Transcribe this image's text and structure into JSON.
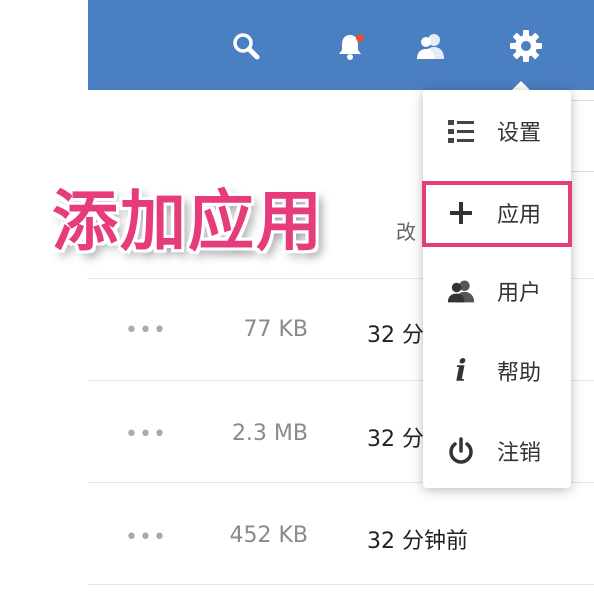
{
  "header": {
    "icons": [
      "search-icon",
      "bell-icon",
      "contacts-icon",
      "gear-icon"
    ],
    "notification_dot_color": "#e0523f",
    "bar_color": "#4a7fc1"
  },
  "overlay": {
    "title": "添加应用",
    "color": "#e63c7c"
  },
  "column_hint": "改",
  "files": [
    {
      "more": "•••",
      "size": "77 KB",
      "modified": "32 分"
    },
    {
      "more": "•••",
      "size": "2.3 MB",
      "modified": "32 分"
    },
    {
      "more": "•••",
      "size": "452 KB",
      "modified": "32 分钟前"
    }
  ],
  "menu": {
    "items": [
      {
        "icon": "list-settings-icon",
        "label": "设置"
      },
      {
        "icon": "plus-icon",
        "label": "应用",
        "highlighted": true
      },
      {
        "icon": "users-icon",
        "label": "用户"
      },
      {
        "icon": "info-icon",
        "label": "帮助"
      },
      {
        "icon": "power-icon",
        "label": "注销"
      }
    ]
  }
}
